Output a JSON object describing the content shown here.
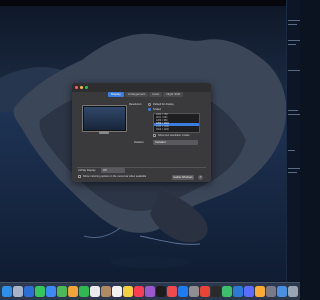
{
  "menubar": {
    "clock": ""
  },
  "window": {
    "tabs": [
      {
        "label": "Display",
        "active": true
      },
      {
        "label": "Arrangement",
        "active": false
      },
      {
        "label": "Color",
        "active": false
      },
      {
        "label": "Night Shift",
        "active": false
      }
    ],
    "resolution_label": "Resolution:",
    "option_default": "Default for display",
    "option_scaled": "Scaled",
    "resolutions": [
      "1024 × 768",
      "1152 × 864",
      "1280 × 960",
      "1280 × 1024",
      "1344 × 1008",
      "1600 × 1200"
    ],
    "selected_resolution_index": 3,
    "show_low_res": "Show low resolution modes",
    "rotation_label": "Rotation:",
    "rotation_value": "Standard",
    "airplay_label": "AirPlay Display:",
    "airplay_value": "Off",
    "mirroring_text": "Show mirroring options in the menu bar when available",
    "gather_button": "Gather Windows",
    "help_button": "?"
  },
  "dock": {
    "icon_names": [
      "finder-icon",
      "launchpad-icon",
      "safari-icon",
      "messages-icon",
      "mail-icon",
      "maps-icon",
      "photos-icon",
      "facetime-icon",
      "calendar-icon",
      "contacts-icon",
      "reminders-icon",
      "notes-icon",
      "music-icon",
      "podcasts-icon",
      "tv-icon",
      "news-icon",
      "appstore-icon",
      "settings-icon",
      "chrome-icon",
      "terminal-icon",
      "activity-icon",
      "vscode-icon",
      "app-icon",
      "app-icon",
      "app-icon",
      "downloads-icon",
      "trash-icon"
    ],
    "icon_colors": [
      "#2f8fe8",
      "#a7b3c7",
      "#2b6fd6",
      "#34c759",
      "#3d8af7",
      "#4db85a",
      "#f2a33a",
      "#30b94e",
      "#e9e9ee",
      "#b08a62",
      "#f2f2f2",
      "#f4d03f",
      "#fa3c55",
      "#9b59d0",
      "#1c1c1e",
      "#f14a4a",
      "#1e7cf2",
      "#8e8e93",
      "#e94335",
      "#2a2a2a",
      "#3dc06c",
      "#2b7bd4",
      "#5b6cff",
      "#ffaa33",
      "#7a7a88",
      "#4a90e2",
      "#9aa4b2"
    ]
  }
}
